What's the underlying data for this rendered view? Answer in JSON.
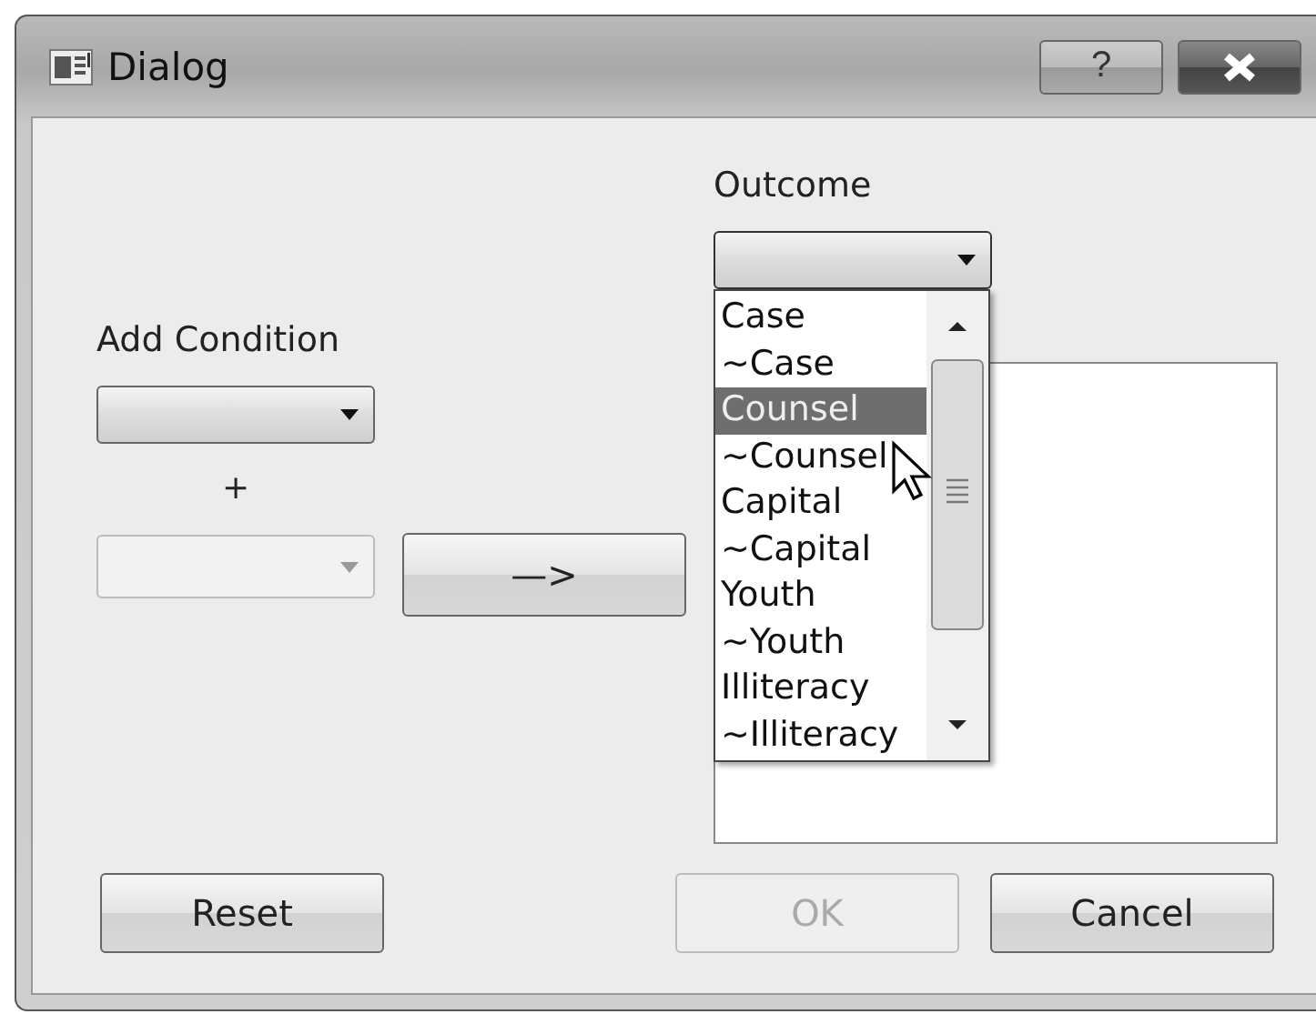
{
  "window": {
    "title": "Dialog",
    "help_button": "?"
  },
  "add_condition": {
    "label": "Add Condition",
    "plus": "+",
    "second_disabled": true
  },
  "arrow_button": {
    "label": "—>"
  },
  "outcome": {
    "label": "Outcome",
    "expanded": true,
    "options": [
      {
        "label": "Case",
        "selected": false
      },
      {
        "label": "~Case",
        "selected": false
      },
      {
        "label": "Counsel",
        "selected": true
      },
      {
        "label": "~Counsel",
        "selected": false
      },
      {
        "label": "Capital",
        "selected": false
      },
      {
        "label": "~Capital",
        "selected": false
      },
      {
        "label": "Youth",
        "selected": false
      },
      {
        "label": "~Youth",
        "selected": false
      },
      {
        "label": "Illiteracy",
        "selected": false
      },
      {
        "label": "~Illiteracy",
        "selected": false
      }
    ]
  },
  "buttons": [
    {
      "label": "Reset",
      "disabled": false
    },
    {
      "label": "OK",
      "disabled": true
    },
    {
      "label": "Cancel",
      "disabled": false
    }
  ]
}
